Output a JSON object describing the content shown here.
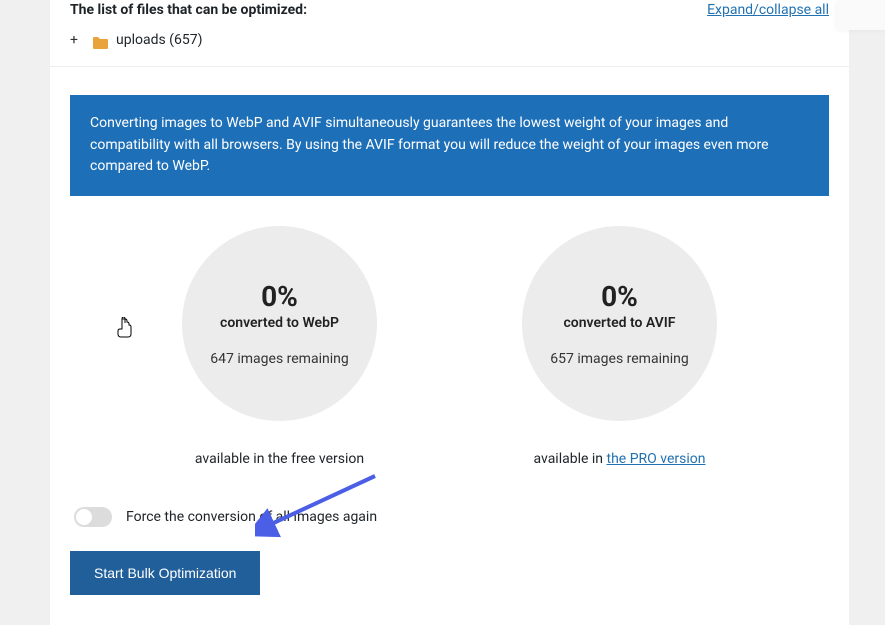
{
  "fileList": {
    "title": "The list of files that can be optimized:",
    "expandLink": "Expand/collapse all",
    "folder": {
      "name": "uploads (657)"
    }
  },
  "banner": "Converting images to WebP and AVIF simultaneously guarantees the lowest weight of your images and compatibility with all browsers. By using the AVIF format you will reduce the weight of your images even more compared to WebP.",
  "stats": {
    "webp": {
      "percent": "0%",
      "label": "converted to WebP",
      "remaining": "647 images remaining",
      "availability": "available in the free version"
    },
    "avif": {
      "percent": "0%",
      "label": "converted to AVIF",
      "remaining": "657 images remaining",
      "availabilityPrefix": "available in ",
      "proLink": "the PRO version"
    }
  },
  "toggle": {
    "label": "Force the conversion of all images again"
  },
  "buttons": {
    "start": "Start Bulk Optimization"
  }
}
